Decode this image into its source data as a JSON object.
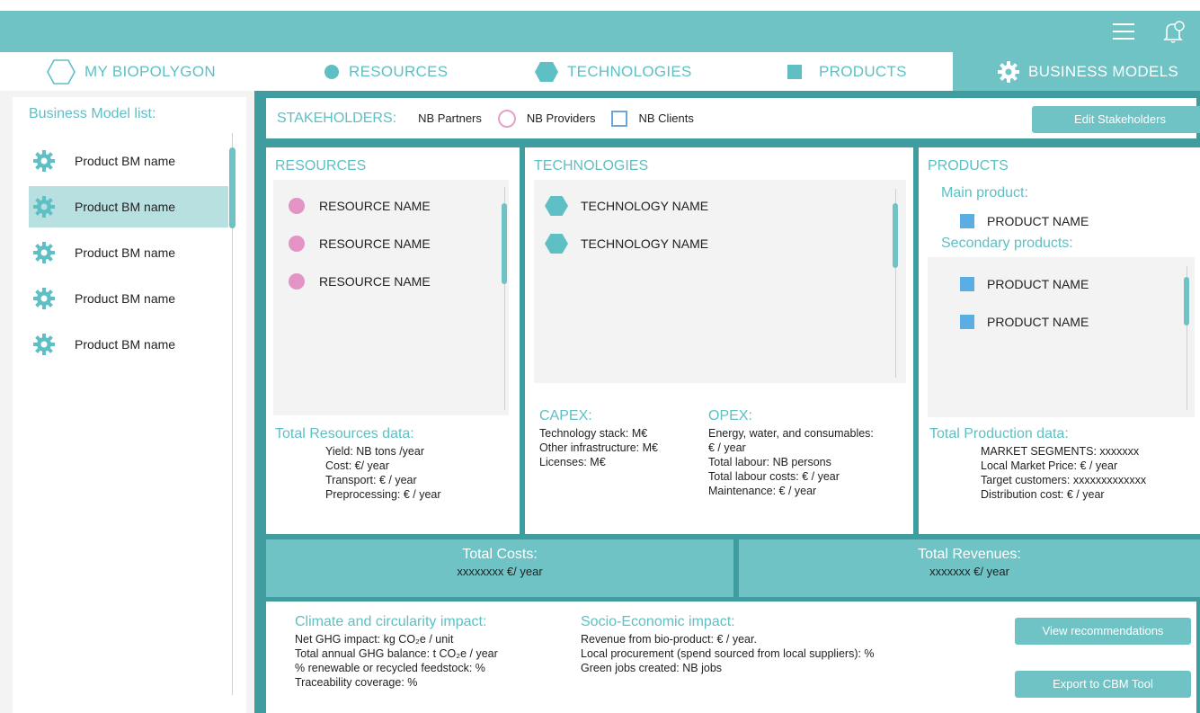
{
  "nav": {
    "items": [
      {
        "label": "MY BIOPOLYGON",
        "icon": "hexagon-outline-icon"
      },
      {
        "label": "RESOURCES",
        "icon": "circle-icon"
      },
      {
        "label": "TECHNOLOGIES",
        "icon": "hexagon-icon"
      },
      {
        "label": "PRODUCTS",
        "icon": "square-icon"
      },
      {
        "label": "BUSINESS MODELS",
        "icon": "gear-icon"
      }
    ],
    "active": "BUSINESS MODELS"
  },
  "topbar": {
    "menu_icon": "hamburger-menu-icon",
    "notify_icon": "bell-icon"
  },
  "sidebar": {
    "title": "Business Model list:",
    "items": [
      "Product BM name",
      "Product BM name",
      "Product BM name",
      "Product BM name",
      "Product BM name"
    ],
    "selected_index": 1
  },
  "stakeholders": {
    "title": "STAKEHOLDERS:",
    "partners": "NB Partners",
    "providers": "NB Providers",
    "clients": "NB Clients",
    "edit_button": "Edit Stakeholders"
  },
  "resources": {
    "title": "RESOURCES",
    "items": [
      "RESOURCE NAME",
      "RESOURCE NAME",
      "RESOURCE NAME"
    ],
    "total_title": "Total Resources data:",
    "lines": [
      "Yield: NB tons /year",
      "Cost: €/ year",
      "Transport: € / year",
      "Preprocessing: € / year"
    ]
  },
  "technologies": {
    "title": "TECHNOLOGIES",
    "items": [
      "TECHNOLOGY NAME",
      "TECHNOLOGY NAME"
    ],
    "capex_title": "CAPEX:",
    "capex_lines": [
      "Technology stack: M€",
      "Other infrastructure: M€",
      "Licenses: M€"
    ],
    "opex_title": "OPEX:",
    "opex_lines": [
      "Energy, water, and consumables:",
      "€ / year",
      "Total labour: NB persons",
      "Total labour costs: € / year",
      "Maintenance: € / year"
    ]
  },
  "products": {
    "title": "PRODUCTS",
    "main_title": "Main product:",
    "main_item": "PRODUCT NAME",
    "secondary_title": "Secondary products:",
    "secondary_items": [
      "PRODUCT NAME",
      "PRODUCT NAME"
    ],
    "total_title": "Total Production data:",
    "lines": [
      "MARKET SEGMENTS: xxxxxxx",
      "Local Market Price: € / year",
      "Target customers: xxxxxxxxxxxxx",
      "Distribution cost: € / year"
    ]
  },
  "totals": {
    "costs_title": "Total Costs:",
    "costs_value": "xxxxxxxx €/ year",
    "revenues_title": "Total Revenues:",
    "revenues_value": "xxxxxxx €/ year"
  },
  "impact": {
    "climate_title": "Climate and circularity impact:",
    "climate_lines": [
      "Net GHG impact: kg CO₂e / unit",
      "Total annual GHG balance: t CO₂e / year",
      "% renewable or recycled feedstock: %",
      "Traceability coverage: %"
    ],
    "socio_title": "Socio-Economic impact:",
    "socio_lines": [
      "Revenue from bio-product: € / year.",
      "Local procurement (spend sourced from local suppliers): %",
      "Green jobs created: NB jobs"
    ],
    "recommendations_button": "View recommendations",
    "export_button": "Export to CBM Tool"
  },
  "colors": {
    "teal": "#6fc3c5",
    "dark_teal": "#3f9c9f",
    "pink": "#e394c4",
    "blue": "#5aaee4"
  }
}
